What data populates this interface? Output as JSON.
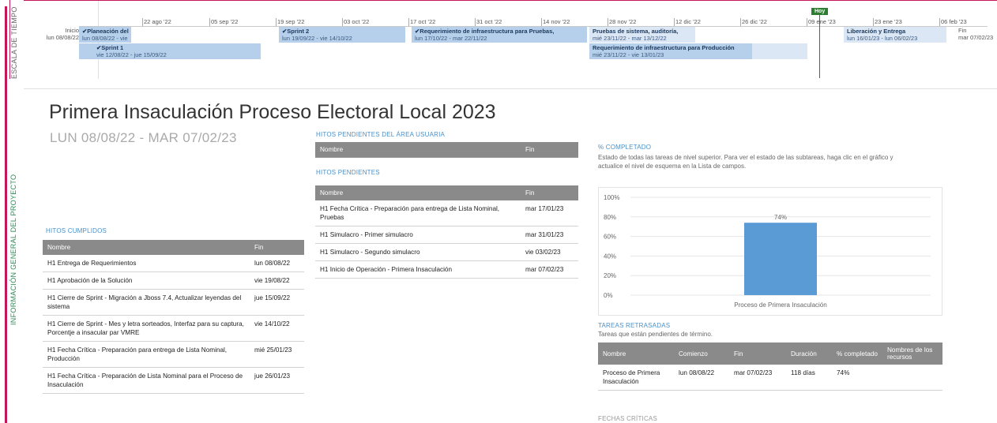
{
  "side_labels": {
    "timeline": "ESCALA DE TIEMPO",
    "info": "INFORMACIÓN GENERAL DEL PROYECTO"
  },
  "timeline": {
    "start_label": "Inicio",
    "start_date": "lun 08/08/22",
    "end_label": "Fin",
    "end_date": "mar 07/02/23",
    "today_label": "Hoy",
    "ticks": [
      "22 ago '22",
      "05 sep '22",
      "19 sep '22",
      "03 oct '22",
      "17 oct '22",
      "31 oct '22",
      "14 nov '22",
      "28 nov '22",
      "12 dic '22",
      "26 dic '22",
      "09 ene '23",
      "23 ene '23",
      "06 feb '23"
    ],
    "tasks": [
      {
        "name": "✔Planeación del",
        "dates": "lun 08/08/22 - vie"
      },
      {
        "name": "✔Sprint 1",
        "dates": "vie 12/08/22 - jue 15/09/22"
      },
      {
        "name": "✔Sprint 2",
        "dates": "lun 19/09/22 - vie 14/10/22"
      },
      {
        "name": "✔Requerimiento de infraestructura para Pruebas,",
        "dates": "lun 17/10/22 - mar 22/11/22"
      },
      {
        "name": "Pruebas de sistema, auditoría,",
        "dates": "mié 23/11/22 - mar 13/12/22"
      },
      {
        "name": "Requerimiento de infraestructura para Producción",
        "dates": "mié 23/11/22 - vie 13/01/23"
      },
      {
        "name": "Liberación y Entrega",
        "dates": "lun 16/01/23 - lun 06/02/23"
      }
    ]
  },
  "header": {
    "title": "Primera Insaculación Proceso Electoral Local 2023",
    "date_range": "LUN 08/08/22 - MAR 07/02/23"
  },
  "hitos_usuaria": {
    "title": "HITOS PENDIENTES DEL ÁREA USUARIA",
    "columns": [
      "Nombre",
      "Fin"
    ]
  },
  "hitos_pendientes": {
    "title": "HITOS PENDIENTES",
    "columns": [
      "Nombre",
      "Fin"
    ],
    "rows": [
      [
        "H1 Fecha Crítica - Preparación para entrega de Lista Nominal, Pruebas",
        "mar 17/01/23"
      ],
      [
        "H1 Simulacro - Primer simulacro",
        "mar 31/01/23"
      ],
      [
        "H1 Simulacro - Segundo simulacro",
        "vie 03/02/23"
      ],
      [
        "H1 Inicio de Operación - Primera Insaculación",
        "mar 07/02/23"
      ]
    ]
  },
  "hitos_cumplidos": {
    "title": "HITOS CUMPLIDOS",
    "columns": [
      "Nombre",
      "Fin"
    ],
    "rows": [
      [
        "H1 Entrega de Requerimientos",
        "lun 08/08/22"
      ],
      [
        "H1 Aprobación de la Solución",
        "vie 19/08/22"
      ],
      [
        "H1 Cierre de Sprint - Migración a Jboss 7.4, Actualizar leyendas del sistema",
        "jue 15/09/22"
      ],
      [
        "H1 Cierre de Sprint - Mes y letra sorteados, Interfaz para su captura, Porcentje a insacular par VMRE",
        "vie 14/10/22"
      ],
      [
        "H1 Fecha Crítica - Preparación para entrega de Lista Nominal, Producción",
        "mié 25/01/23"
      ],
      [
        "H1 Fecha Crítica - Preparación de Lista Nominal para el Proceso de Insaculación",
        "jue 26/01/23"
      ]
    ]
  },
  "completado": {
    "title": "% COMPLETADO",
    "description": "Estado de todas las tareas de nivel superior. Para ver el estado de las subtareas, haga clic en el gráfico y actualice el nivel de esquema en la Lista de campos."
  },
  "chart_data": {
    "type": "bar",
    "categories": [
      "Proceso de Primera Insaculación"
    ],
    "values": [
      74
    ],
    "value_labels": [
      "74%"
    ],
    "ylim": [
      0,
      100
    ],
    "yticks": [
      "0%",
      "20%",
      "40%",
      "60%",
      "80%",
      "100%"
    ],
    "color": "#5b9bd5"
  },
  "retrasadas": {
    "title": "TAREAS RETRASADAS",
    "description": "Tareas que están pendientes de término.",
    "columns": [
      "Nombre",
      "Comienzo",
      "Fin",
      "Duración",
      "% completado",
      "Nombres de los recursos"
    ],
    "rows": [
      [
        "Proceso de Primera Insaculación",
        "lun 08/08/22",
        "mar 07/02/23",
        "118 días",
        "74%",
        ""
      ]
    ]
  },
  "fechas_criticas": {
    "title": "FECHAS CRÍTICAS"
  }
}
